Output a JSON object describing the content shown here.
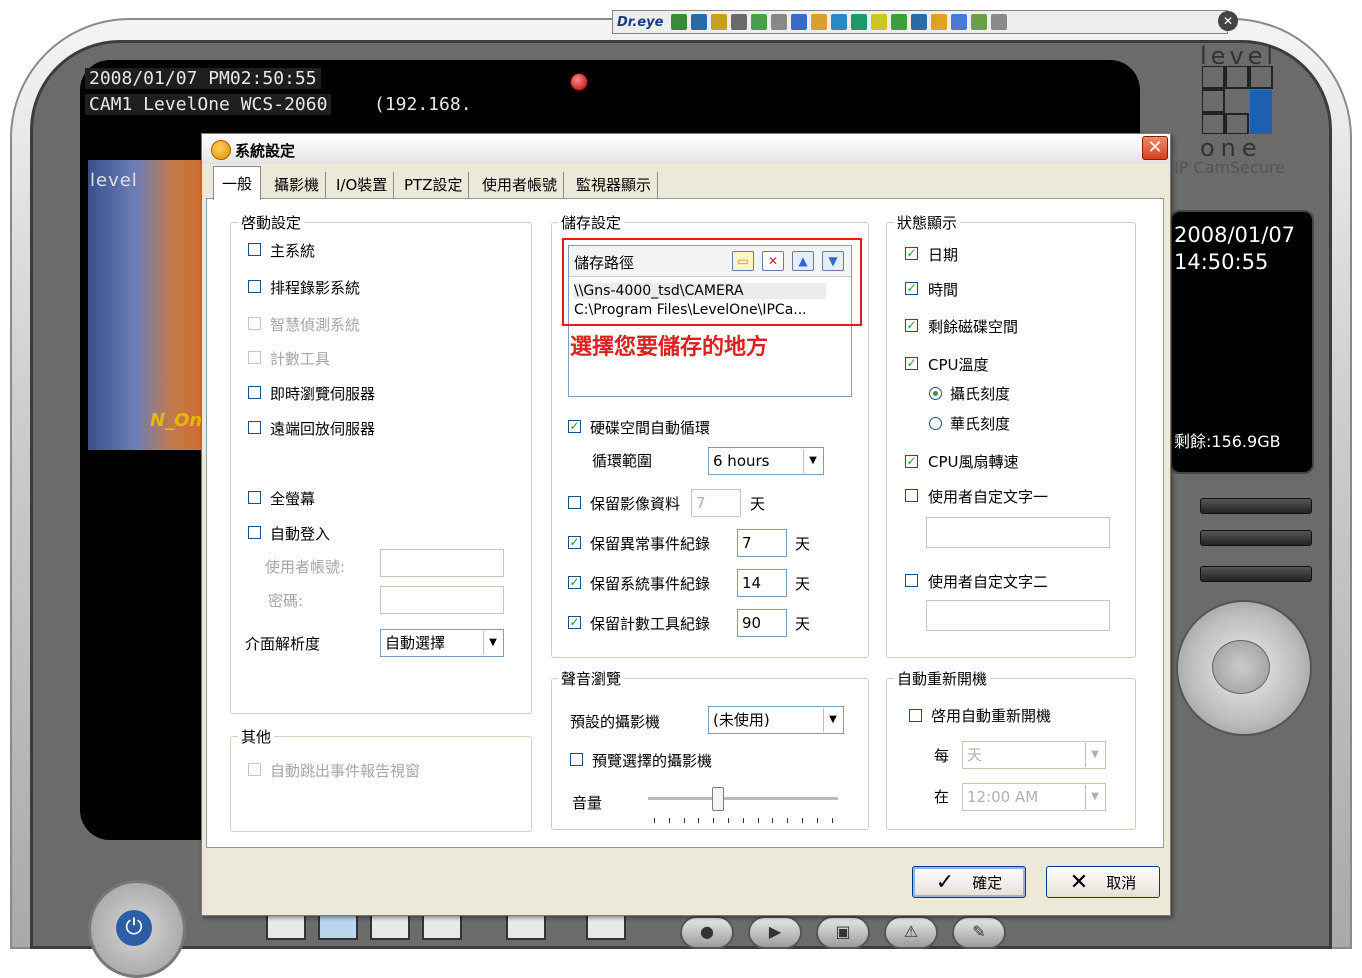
{
  "toolbar": {
    "dreye_label": "Dr.eye"
  },
  "video": {
    "overlay_datetime": "2008/01/07 PM02:50:55",
    "overlay_camera": "CAM1 LevelOne WCS-2060",
    "overlay_ip": "(192.168.",
    "scene_logo": "level",
    "scene_sign": "N_On"
  },
  "side_panel": {
    "logo_top": "level",
    "logo_bottom": "one",
    "logo_sub": "IP CamSecure",
    "date": "2008/01/07",
    "time": "14:50:55",
    "disk_free": "剩餘:156.9GB"
  },
  "dialog": {
    "title": "系統設定",
    "tabs": [
      "一般",
      "攝影機",
      "I/O裝置",
      "PTZ設定",
      "使用者帳號",
      "監視器顯示"
    ],
    "startup": {
      "title": "啓動設定",
      "main_system": "主系統",
      "schedule_record": "排程錄影系統",
      "smart_detect": "智慧偵測系統",
      "counter_tool": "計數工具",
      "live_server": "即時瀏覽伺服器",
      "remote_playback": "遠端回放伺服器",
      "fullscreen": "全螢幕",
      "auto_login": "自動登入",
      "username_label": "使用者帳號:",
      "password_label": "密碼:",
      "resolution_label": "介面解析度",
      "resolution_value": "自動選擇"
    },
    "other": {
      "title": "其他",
      "auto_popup": "自動跳出事件報告視窗"
    },
    "storage": {
      "title": "儲存設定",
      "path_header": "儲存路徑",
      "paths": [
        "\\\\Gns-4000_tsd\\CAMERA",
        "C:\\Program Files\\LevelOne\\IPCa..."
      ],
      "hint": "選擇您要儲存的地方",
      "auto_recycle": "硬碟空間自動循環",
      "recycle_range_label": "循環範圍",
      "recycle_range_value": "6 hours",
      "keep_video": "保留影像資料",
      "keep_video_days": "7",
      "keep_abnormal": "保留異常事件紀錄",
      "keep_abnormal_days": "7",
      "keep_system": "保留系統事件紀錄",
      "keep_system_days": "14",
      "keep_counter": "保留計數工具紀錄",
      "keep_counter_days": "90",
      "day_unit": "天"
    },
    "audio": {
      "title": "聲音瀏覽",
      "default_camera_label": "預設的攝影機",
      "default_camera_value": "(未使用)",
      "preview_selected": "預覽選擇的攝影機",
      "volume_label": "音量",
      "volume_level": 0.37
    },
    "status": {
      "title": "狀態顯示",
      "date": "日期",
      "time": "時間",
      "disk_free": "剩餘磁碟空間",
      "cpu_temp": "CPU溫度",
      "celsius": "攝氏刻度",
      "fahrenheit": "華氏刻度",
      "cpu_fan": "CPU風扇轉速",
      "custom_text_1": "使用者自定文字一",
      "custom_text_2": "使用者自定文字二"
    },
    "reboot": {
      "title": "自動重新開機",
      "enable": "啓用自動重新開機",
      "every_label": "每",
      "every_value": "天",
      "at_label": "在",
      "at_value": "12:00 AM"
    },
    "ok_label": "確定",
    "cancel_label": "取消"
  },
  "colors": {
    "dialog_bg": "#ece9d8",
    "highlight_red": "#e02020",
    "check_green": "#21a121"
  }
}
